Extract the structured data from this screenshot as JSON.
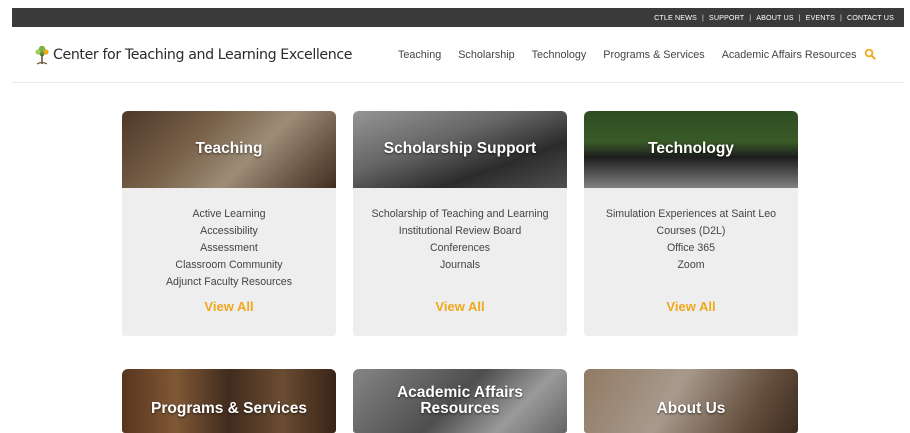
{
  "topbar": {
    "links": [
      "CTLE NEWS",
      "SUPPORT",
      "ABOUT US",
      "EVENTS",
      "CONTACT US"
    ],
    "separator": "|"
  },
  "header": {
    "logo_text": "Center for Teaching and Learning Excellence",
    "logo_icon": "tree-icon",
    "nav": [
      "Teaching",
      "Scholarship",
      "Technology",
      "Programs & Services",
      "Academic Affairs Resources"
    ],
    "search_icon": "search-icon",
    "accent_color": "#f0a81c"
  },
  "cards": [
    {
      "title": "Teaching",
      "items": [
        "Active Learning",
        "Accessibility",
        "Assessment",
        "Classroom Community",
        "Adjunct Faculty Resources"
      ],
      "link": "View All"
    },
    {
      "title": "Scholarship Support",
      "items": [
        "Scholarship of Teaching and Learning",
        "Institutional Review Board",
        "Conferences",
        "Journals"
      ],
      "link": "View All"
    },
    {
      "title": "Technology",
      "items": [
        "Simulation Experiences at Saint Leo",
        "Courses (D2L)",
        "Office 365",
        "Zoom"
      ],
      "link": "View All"
    }
  ],
  "bottom_cards": [
    {
      "title": "Programs & Services"
    },
    {
      "title": "Academic Affairs Resources"
    },
    {
      "title": "About Us"
    }
  ]
}
